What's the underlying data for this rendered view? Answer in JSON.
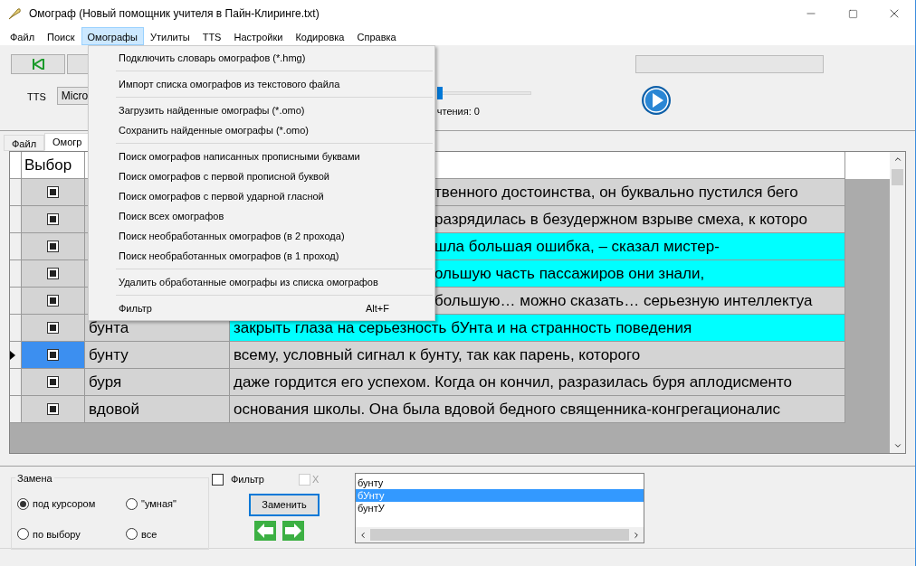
{
  "window": {
    "title": "Омограф (Новый помощник учителя в Пайн-Клиринге.txt)"
  },
  "menu_bar": [
    {
      "label": "Файл",
      "selected": false
    },
    {
      "label": "Поиск",
      "selected": false
    },
    {
      "label": "Омографы",
      "selected": true
    },
    {
      "label": "Утилиты",
      "selected": false
    },
    {
      "label": "TTS",
      "selected": false
    },
    {
      "label": "Настройки",
      "selected": false
    },
    {
      "label": "Кодировка",
      "selected": false
    },
    {
      "label": "Справка",
      "selected": false
    }
  ],
  "dropdown": [
    {
      "kind": "item",
      "label": "Подключить словарь омографов (*.hmg)"
    },
    {
      "kind": "separator"
    },
    {
      "kind": "item",
      "label": "Импорт списка омографов из текстового файла"
    },
    {
      "kind": "separator"
    },
    {
      "kind": "item",
      "label": "Загрузить найденные омографы (*.omo)"
    },
    {
      "kind": "item",
      "label": "Сохранить найденные омографы (*.omo)"
    },
    {
      "kind": "separator"
    },
    {
      "kind": "item",
      "label": "Поиск омографов написанных прописными буквами"
    },
    {
      "kind": "item",
      "label": "Поиск омографов с первой прописной буквой"
    },
    {
      "kind": "item",
      "label": "Поиск омографов с первой ударной гласной"
    },
    {
      "kind": "item",
      "label": "Поиск всех омографов"
    },
    {
      "kind": "item",
      "label": "Поиск необработанных омографов (в 2 прохода)"
    },
    {
      "kind": "item",
      "label": "Поиск необработанных омографов (в 1 проход)"
    },
    {
      "kind": "separator"
    },
    {
      "kind": "item",
      "label": "Удалить обработанные омографы из списка омографов"
    },
    {
      "kind": "separator"
    },
    {
      "kind": "item",
      "label": "Фильтр",
      "shortcut": "Alt+F"
    }
  ],
  "toolbar": {
    "progress": {
      "level": 0
    },
    "tts_label": "TTS",
    "tts_engine": "Micro",
    "speed": {
      "level": 0
    },
    "reading": "чтения: 0"
  },
  "tabs": [
    {
      "label": "Файл",
      "selected": false
    },
    {
      "label": "Омогр",
      "selected": true
    }
  ],
  "table": {
    "columns": [
      "Выбор"
    ],
    "rows": [
      {
        "checked": true,
        "selected": false,
        "highlighted": false,
        "text": "твенного достоинства, он буквально пустился бего"
      },
      {
        "checked": true,
        "selected": false,
        "highlighted": false,
        "text": "разрядилась в безудержном взрыве смеха, к которо"
      },
      {
        "checked": true,
        "selected": false,
        "highlighted": true,
        "text": "шла большая ошибка, – сказал мистер-"
      },
      {
        "checked": true,
        "selected": false,
        "highlighted": true,
        "text": "ольшую часть пассажиров они знали,"
      },
      {
        "checked": true,
        "selected": false,
        "highlighted": false,
        "text": "большую… можно сказать… серьезную интеллектуа"
      },
      {
        "checked": true,
        "selected": false,
        "highlighted": true,
        "word": "бунта",
        "text": "закрыть глаза на серьезность бУнта и на странность поведения"
      },
      {
        "checked": true,
        "selected": true,
        "highlighted": false,
        "word": "бунту",
        "text": "всему, условный сигнал к бунту, так как парень, которого"
      },
      {
        "checked": true,
        "selected": false,
        "highlighted": false,
        "word": "буря",
        "text": "даже гордится его успехом. Когда он кончил, разразилась буря аплодисменто"
      },
      {
        "checked": true,
        "selected": false,
        "highlighted": false,
        "word": "вдовой",
        "text": "основания школы. Она была вдовой бедного священника-конгрегационалис"
      }
    ]
  },
  "replace_group": {
    "title": "Замена",
    "options": [
      {
        "label": "под курсором",
        "selected": true
      },
      {
        "label": "\"умная\"",
        "selected": false
      },
      {
        "label": "по выбору",
        "selected": false
      },
      {
        "label": "все",
        "selected": false
      }
    ]
  },
  "filter": {
    "label": "Фильтр",
    "checked": false
  },
  "x_option": {
    "label": "X",
    "checked": false,
    "disabled": true
  },
  "replace_button": "Заменить",
  "variants": [
    {
      "label": "бунту",
      "selected": false
    },
    {
      "label": "бУнту",
      "selected": true
    },
    {
      "label": "бунтУ",
      "selected": false
    }
  ]
}
